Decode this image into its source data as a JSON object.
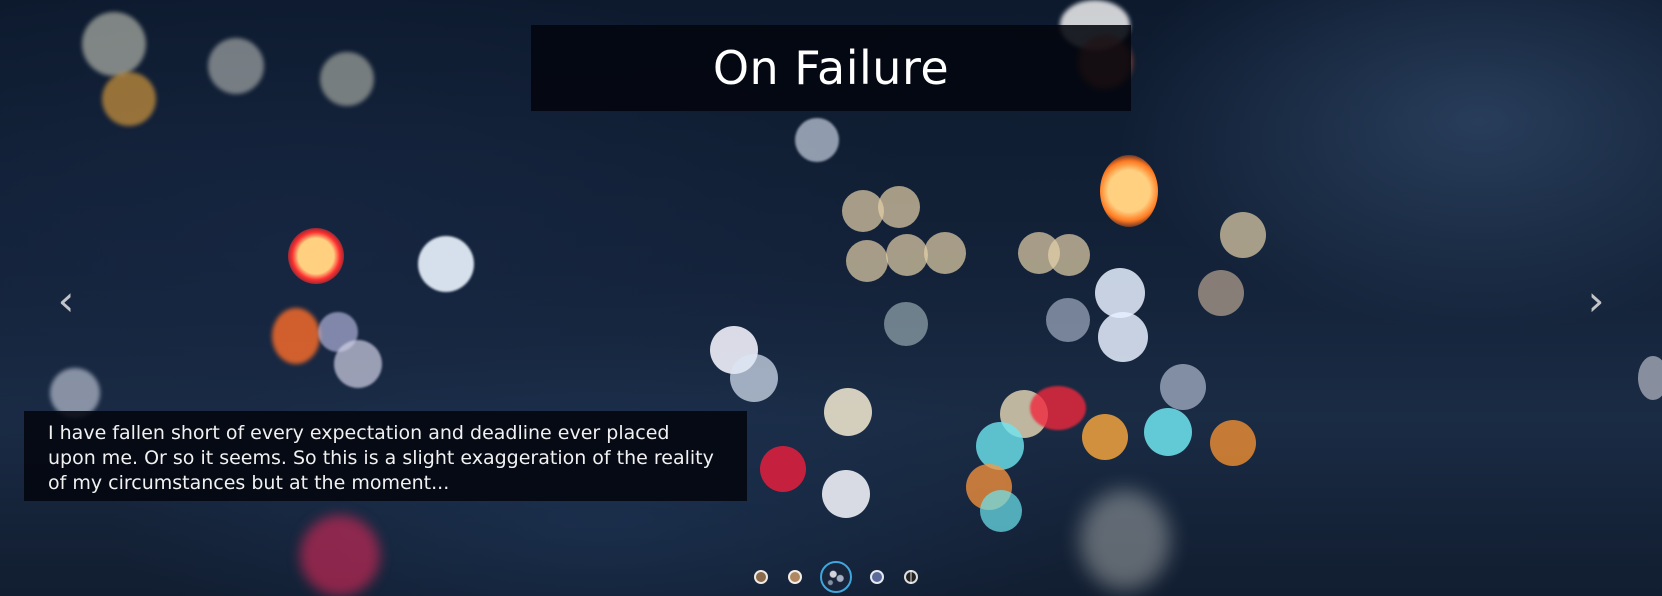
{
  "slider": {
    "title": "On Failure",
    "excerpt": "I have fallen short of every expectation and deadline ever placed upon me. Or so it seems. So this is a slight exaggeration of the reality of my circumstances but at the moment...",
    "prev_arrow": "‹",
    "next_arrow": "›",
    "slide_count": 5,
    "active_slide": 3,
    "colors": {
      "caption_background": "#03060e",
      "active_dot_border": "#3fa7dd"
    }
  }
}
